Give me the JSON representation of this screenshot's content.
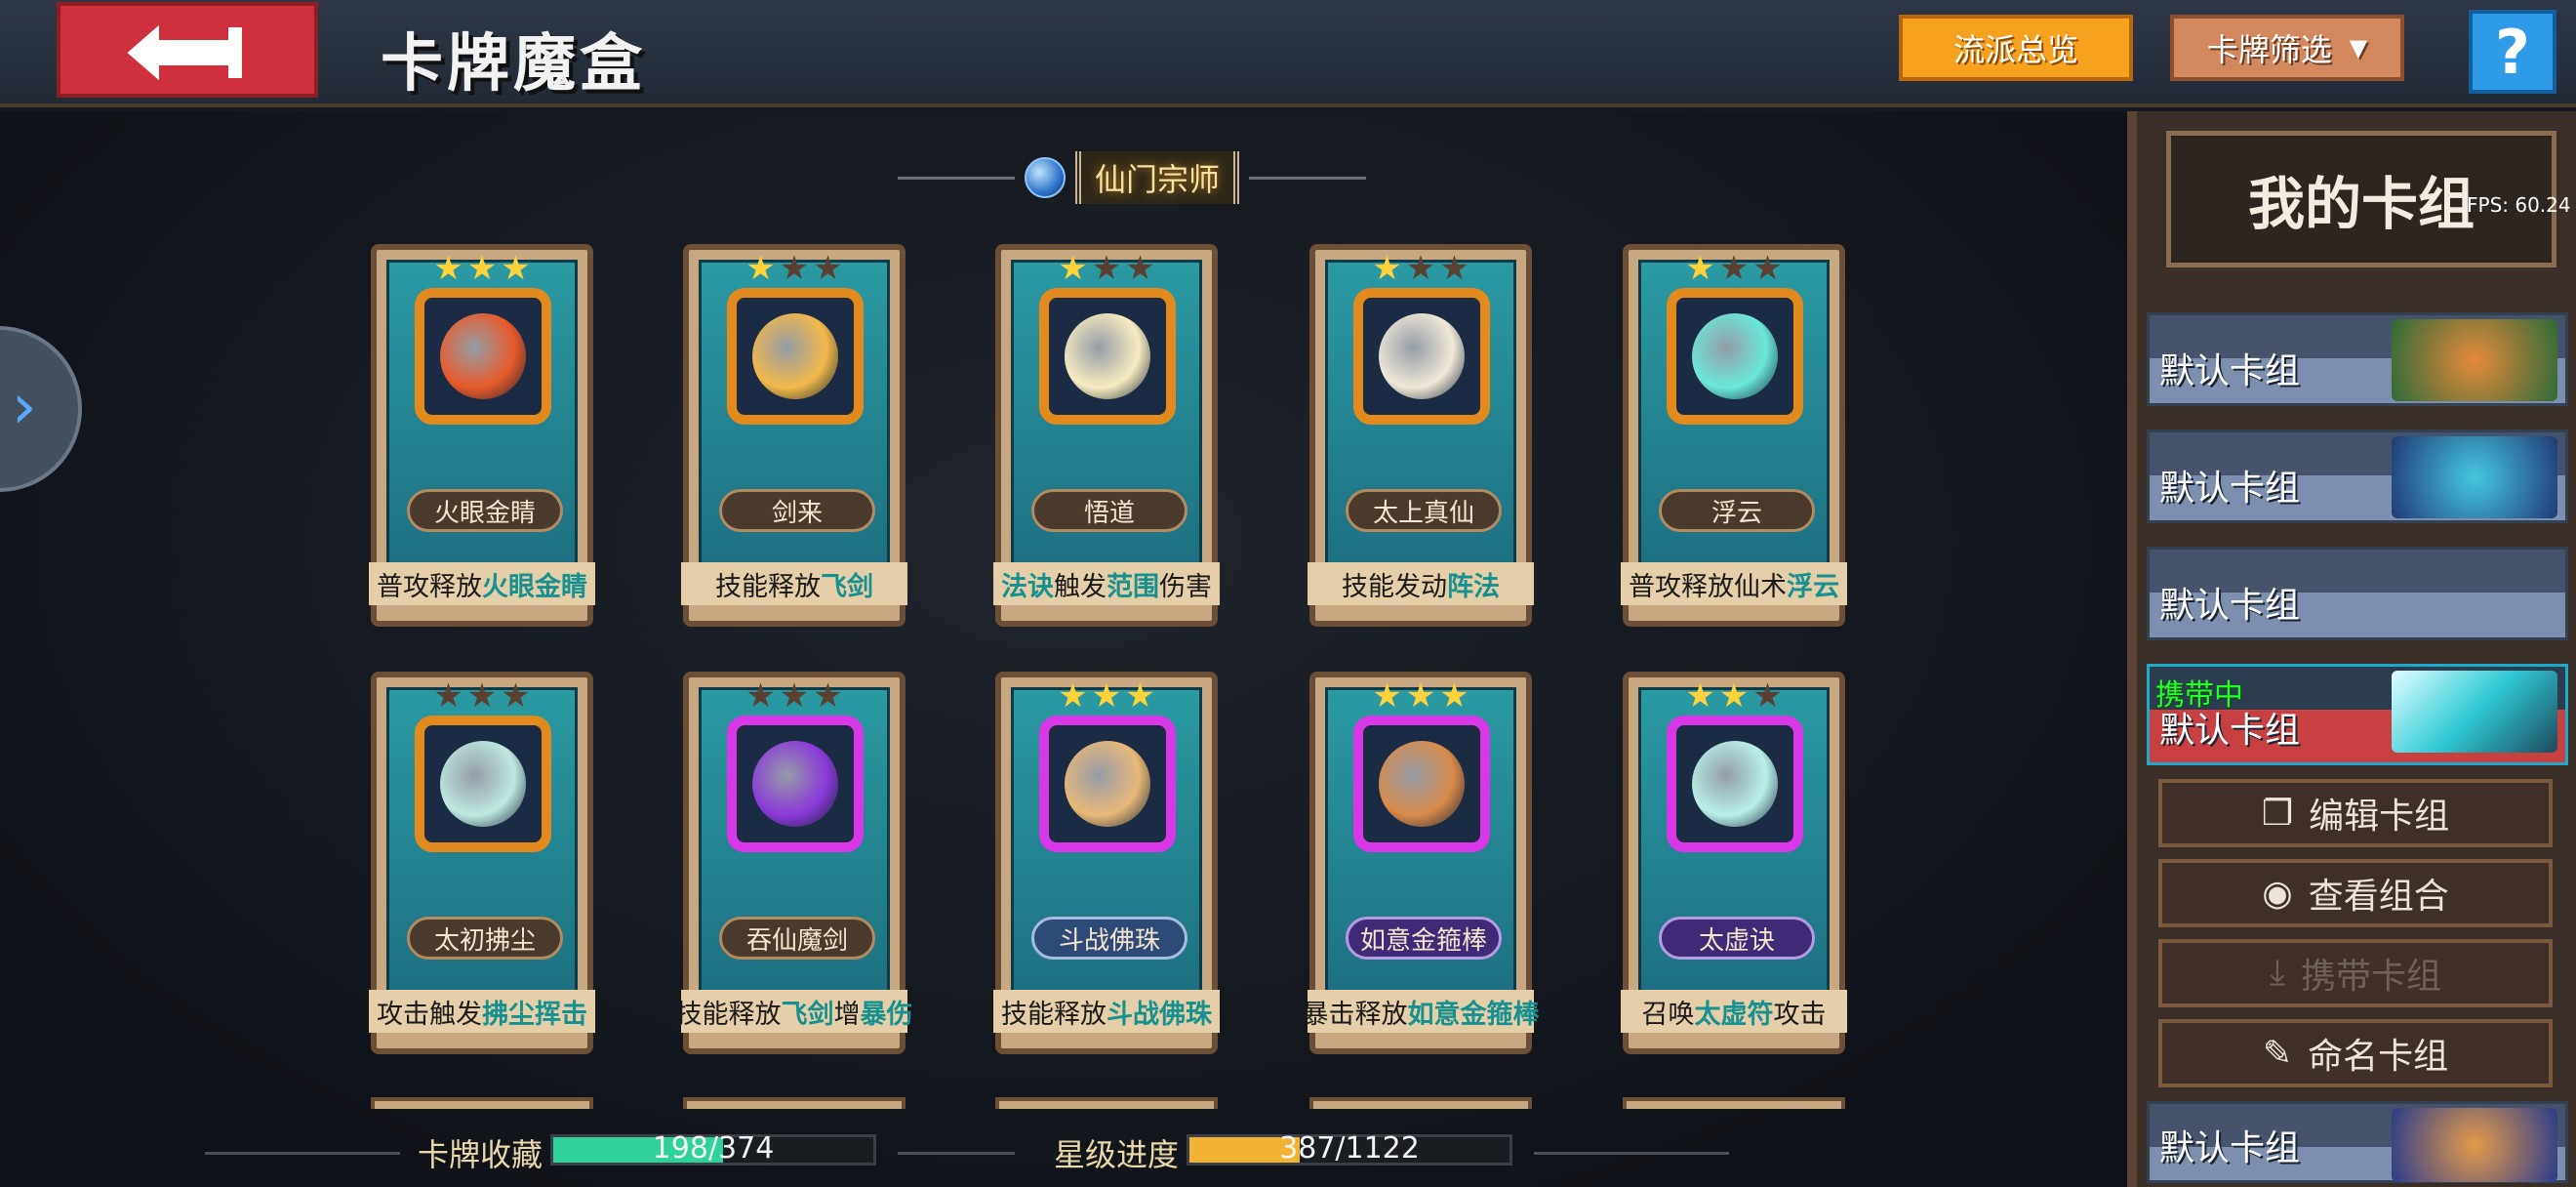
{
  "header": {
    "title": "卡牌魔盒",
    "overview_label": "流派总览",
    "filter_label": "卡牌筛选",
    "help_label": "?"
  },
  "section": {
    "title": "仙门宗师"
  },
  "cards": [
    {
      "name": "火眼金睛",
      "stars": 3,
      "desc_parts": [
        "普攻释放",
        "火眼金睛"
      ]
    },
    {
      "name": "剑来",
      "stars": 1,
      "desc_parts": [
        "技能释放",
        "飞剑"
      ]
    },
    {
      "name": "悟道",
      "stars": 1,
      "desc_parts": [
        "法诀",
        "触发",
        "范围",
        "伤害"
      ]
    },
    {
      "name": "太上真仙",
      "stars": 1,
      "desc_parts": [
        "技能发动",
        "阵法"
      ]
    },
    {
      "name": "浮云",
      "stars": 1,
      "desc_parts": [
        "普攻释放仙术",
        "浮云"
      ]
    },
    {
      "name": "太初拂尘",
      "stars": 0,
      "desc_parts": [
        "攻击触发",
        "拂尘挥击"
      ]
    },
    {
      "name": "吞仙魔剑",
      "stars": 0,
      "desc_parts": [
        "技能释放",
        "飞剑",
        "增",
        "暴伤"
      ]
    },
    {
      "name": "斗战佛珠",
      "stars": 3,
      "desc_parts": [
        "技能释放",
        "斗战佛珠"
      ]
    },
    {
      "name": "如意金箍棒",
      "stars": 3,
      "desc_parts": [
        "暴击释放",
        "如意金箍棒"
      ]
    },
    {
      "name": "太虚诀",
      "stars": 2,
      "desc_parts": [
        "召唤",
        "太虚符",
        "攻击"
      ]
    }
  ],
  "progress": {
    "collection_label": "卡牌收藏",
    "collection_text": "198/374",
    "collection_value": 198,
    "collection_total": 374,
    "star_label": "星级进度",
    "star_text": "387/1122",
    "star_value": 387,
    "star_total": 1122
  },
  "right_panel": {
    "title": "我的卡组",
    "fps": "FPS: 60.24",
    "decks": [
      "默认卡组",
      "默认卡组",
      "默认卡组",
      "默认卡组",
      "默认卡组"
    ],
    "carrying_label": "携带中",
    "actions": {
      "edit": "编辑卡组",
      "view": "查看组合",
      "carry": "携带卡组",
      "rename": "命名卡组"
    }
  },
  "colors": {
    "accent_orange": "#f6a21f",
    "filter_brown": "#d3895d",
    "help_blue": "#2f9ae8",
    "back_red": "#d0303c",
    "collection_fill": "#2fd39a",
    "star_fill": "#f2b233",
    "carrying_green": "#22ff2a"
  },
  "icons": [
    "back-arrow-icon",
    "dropdown-triangle-icon",
    "question-icon",
    "chevron-right-icon",
    "star-icon",
    "copy-icon",
    "eye-icon",
    "download-icon",
    "pencil-icon",
    "orb-icon"
  ]
}
